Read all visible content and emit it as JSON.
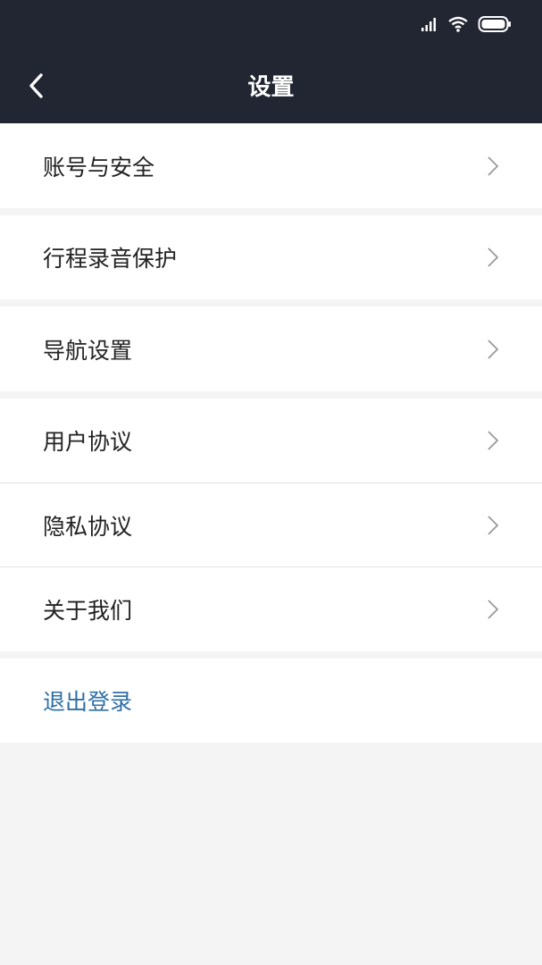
{
  "header": {
    "title": "设置",
    "back_icon": "chevron-left-icon",
    "background": "#222633"
  },
  "status_bar": {
    "icons": [
      "signal-icon",
      "wifi-icon",
      "battery-icon"
    ]
  },
  "menu": {
    "items": [
      {
        "label": "账号与安全",
        "icon": "chevron-right-icon"
      },
      {
        "label": "行程录音保护",
        "icon": "chevron-right-icon"
      },
      {
        "label": "导航设置",
        "icon": "chevron-right-icon"
      },
      {
        "label": "用户协议",
        "icon": "chevron-right-icon"
      },
      {
        "label": "隐私协议",
        "icon": "chevron-right-icon"
      },
      {
        "label": "关于我们",
        "icon": "chevron-right-icon"
      }
    ]
  },
  "logout": {
    "label": "退出登录",
    "color": "#2f6fa6"
  }
}
